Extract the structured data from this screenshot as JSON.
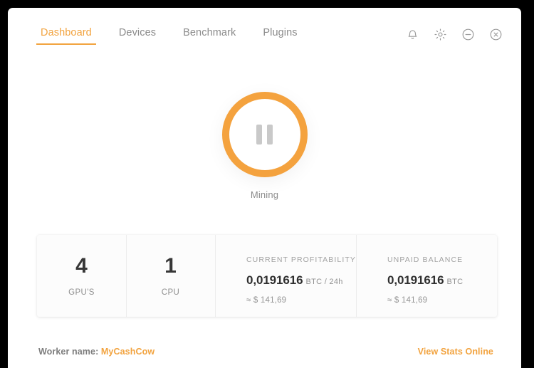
{
  "window": {
    "background_color": "#000000",
    "surface_color": "#ffffff",
    "accent_color": "#f2a33f"
  },
  "header": {
    "tabs": [
      {
        "label": "Dashboard",
        "active": true
      },
      {
        "label": "Devices",
        "active": false
      },
      {
        "label": "Benchmark",
        "active": false
      },
      {
        "label": "Plugins",
        "active": false
      }
    ],
    "window_icons": [
      {
        "name": "bell-icon",
        "title": "Notifications"
      },
      {
        "name": "gear-icon",
        "title": "Settings"
      },
      {
        "name": "minimize-icon",
        "title": "Minimize"
      },
      {
        "name": "close-icon",
        "title": "Close"
      }
    ]
  },
  "mining": {
    "button_icon": "pause-icon",
    "status_label": "Mining",
    "ring_color": "#f4a23e"
  },
  "stats": {
    "gpu": {
      "value": "4",
      "caption": "GPU'S"
    },
    "cpu": {
      "value": "1",
      "caption": "CPU"
    },
    "profitability": {
      "label": "CURRENT PROFITABILITY",
      "value": "0,0191616",
      "unit": "BTC / 24h",
      "approx": "≈ $ 141,69"
    },
    "unpaid_balance": {
      "label": "UNPAID BALANCE",
      "value": "0,0191616",
      "unit": "BTC",
      "approx": "≈ $ 141,69"
    }
  },
  "footer": {
    "worker_prefix": "Worker name:",
    "worker_name": "MyCashCow",
    "view_stats_label": "View Stats Online"
  }
}
